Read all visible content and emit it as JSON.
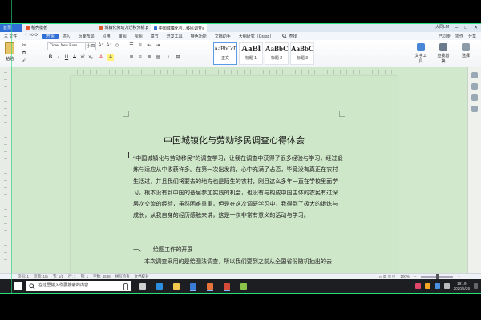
{
  "tabs": {
    "home": "首页",
    "items": [
      {
        "label": "稻壳模板",
        "color": "#e8532f"
      },
      {
        "label": "城镇化劳动力迁移分析.pptx",
        "color": "#e05a2a"
      },
      {
        "label": "中国城镇化与...移民调查心得体会",
        "color": "#2f6fd6"
      }
    ],
    "user": "大同LM"
  },
  "menu": {
    "file": "三 文件",
    "items": [
      "开始",
      "插入",
      "页面布局",
      "引用",
      "审阅",
      "视图",
      "章节",
      "开发工具",
      "特色功能",
      "文档助手",
      "大纲研究（Grasp）"
    ],
    "active_index": 0,
    "search": "查找",
    "right": [
      "已同步",
      "协作",
      "分享"
    ]
  },
  "ribbon": {
    "paste": "粘贴",
    "font_name": "Times New Rom",
    "font_size": "小四",
    "styles": [
      {
        "sample": "AaBbCcDd",
        "name": "正文",
        "size": "small"
      },
      {
        "sample": "AaBl",
        "name": "标题 1",
        "size": "big"
      },
      {
        "sample": "AaBbC",
        "name": "标题 2",
        "size": "mid"
      },
      {
        "sample": "AaBbC",
        "name": "标题 3",
        "size": "mid"
      }
    ],
    "tools": [
      "文字工具",
      "查找替换",
      "选择"
    ]
  },
  "document": {
    "title": "中国城镇化与劳动移民调查心得体会",
    "paragraphs": [
      "“中国城镇化与劳动移民”的调查学习，让我在调查中获得了很多经验与学习，经过锻炼与适应从中收获许多。在第一次出发前，心中充满了忐忑，毕竟没有真正在农村生活过，并且我们将要去的地方也是陌生的农村，刚且这么多年一直在学校里面学习，根本没有到中国的基层参加实践的机会，也没有与构成中国主体的农民有过深层次交流的经验，虽然困难重重，但是在这次调研学习中，我得到了极大的锻炼与成长，从我自身的经历感触来讲，这是一次非常有意义的活动与学习。",
      "一、　　绘图工作的开展",
      "本次调查采用的是绘图法调查，所以我们要到之前从全国省份随机抽出的去"
    ]
  },
  "statusbar": {
    "left": [
      "页码: 1",
      "页面: 1/5",
      "节: 1/1",
      "行: 1",
      "列: 1",
      "字数: 4538",
      "拼写检查",
      "文档校对"
    ],
    "zoom": "100%"
  },
  "taskbar": {
    "search_placeholder": "在这里输入你要搜索的内容",
    "time": "19:19",
    "date": "2020/5/26",
    "apps": [
      {
        "name": "task-view",
        "color": "#cfcfcf",
        "running": false
      },
      {
        "name": "edge",
        "color": "#2d8fe0",
        "running": false
      },
      {
        "name": "explorer",
        "color": "#f2c94c",
        "running": false
      },
      {
        "name": "wps-writer",
        "color": "#3a7bd5",
        "running": true
      },
      {
        "name": "wps-presentation",
        "color": "#e8743b",
        "running": true
      },
      {
        "name": "wps-office",
        "color": "#d64a3a",
        "running": true
      },
      {
        "name": "media",
        "color": "#8bc34a",
        "running": false
      }
    ],
    "tray_colors": [
      "#e0466b",
      "#f5a623",
      "#4a90e2",
      "#bbbbbb"
    ]
  },
  "colors": {
    "accent": "#2f6fd6",
    "page_tint": "#cfe7c9",
    "overlay_frame": "#27e07a"
  }
}
